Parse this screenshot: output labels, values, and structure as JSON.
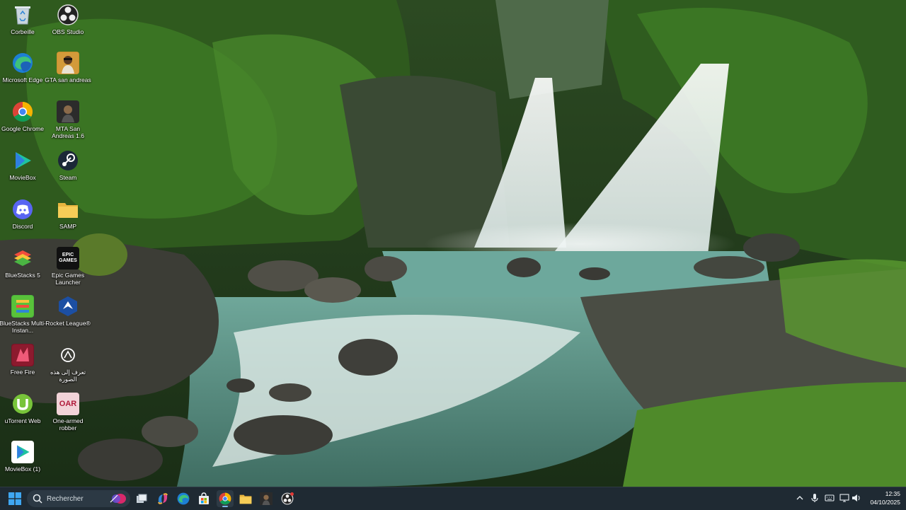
{
  "desktop": {
    "icons": [
      {
        "label": "Corbeille",
        "icon": "recycle-bin-icon"
      },
      {
        "label": "OBS Studio",
        "icon": "obs-studio-icon"
      },
      {
        "label": "Microsoft Edge",
        "icon": "edge-icon"
      },
      {
        "label": "GTA san andreas",
        "icon": "gta-icon"
      },
      {
        "label": "Google Chrome",
        "icon": "chrome-icon"
      },
      {
        "label": "MTA San Andreas 1.6",
        "icon": "mta-icon"
      },
      {
        "label": "MovieBox",
        "icon": "moviebox-icon"
      },
      {
        "label": "Steam",
        "icon": "steam-icon"
      },
      {
        "label": "Discord",
        "icon": "discord-icon"
      },
      {
        "label": "SAMP",
        "icon": "folder-icon"
      },
      {
        "label": "BlueStacks 5",
        "icon": "bluestacks-icon"
      },
      {
        "label": "Epic Games Launcher",
        "icon": "epic-games-icon",
        "glyph_text": "EPIC GAMES"
      },
      {
        "label": "BlueStacks Multi-Instan...",
        "icon": "bluestacks-multi-icon"
      },
      {
        "label": "Rocket League®",
        "icon": "rocket-league-icon"
      },
      {
        "label": "Free Fire",
        "icon": "free-fire-icon"
      },
      {
        "label": "تعرف إلى هذه الصورة",
        "icon": "spotlight-icon"
      },
      {
        "label": "uTorrent Web",
        "icon": "utorrent-icon"
      },
      {
        "label": "One-armed robber",
        "icon": "one-armed-robber-icon",
        "glyph_text": "OAR"
      },
      {
        "label": "MovieBox (1)",
        "icon": "moviebox-icon"
      }
    ]
  },
  "taskbar": {
    "search_placeholder": "Rechercher",
    "apps": [
      "task-view-icon",
      "copilot-icon",
      "edge-icon",
      "store-icon",
      "chrome-icon",
      "file-explorer-icon",
      "mta-icon",
      "obs-studio-icon"
    ],
    "active_app": "chrome-icon",
    "clock": {
      "time": "12:35",
      "date": "04/10/2025"
    }
  },
  "colors": {
    "taskbar_bg": "#1f2a33",
    "accent": "#7db8e8"
  }
}
